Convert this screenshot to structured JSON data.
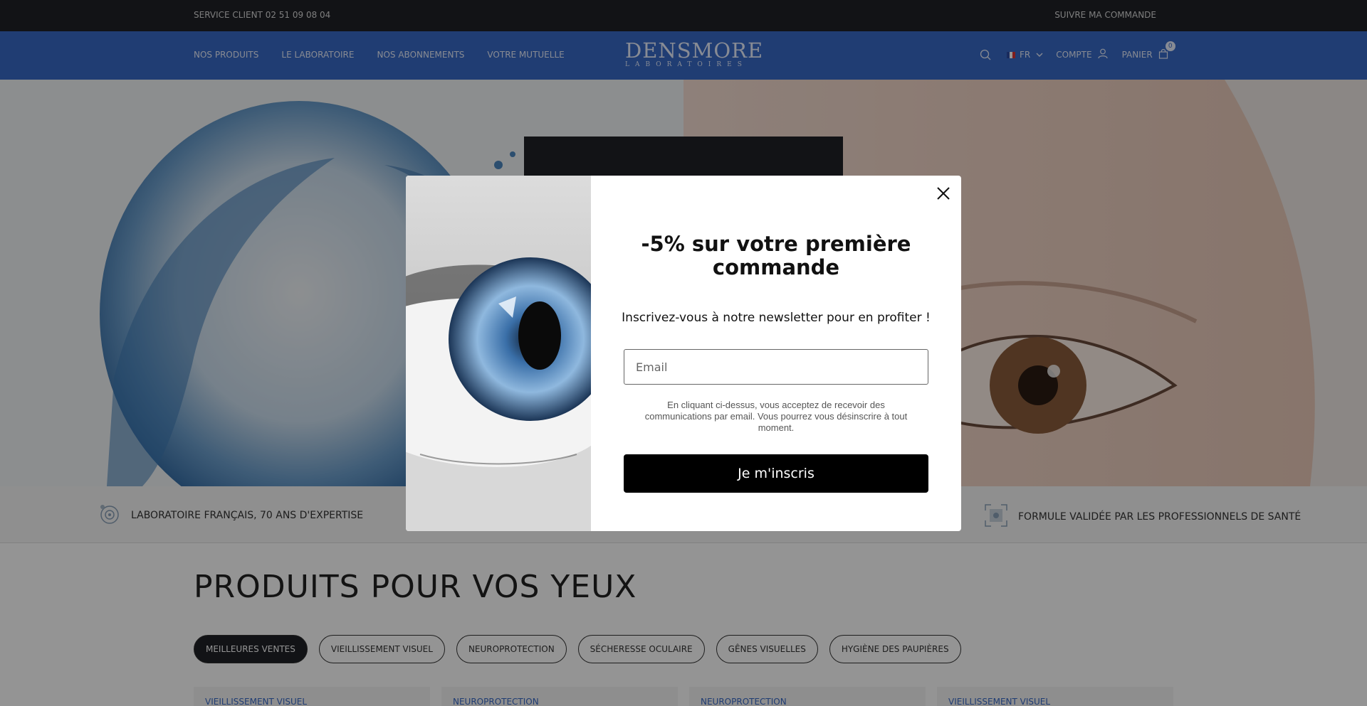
{
  "topbar": {
    "service_client": "SERVICE CLIENT 02 51 09 08 04",
    "track_order": "SUIVRE MA COMMANDE"
  },
  "header": {
    "nav": [
      "NOS PRODUITS",
      "LE LABORATOIRE",
      "NOS ABONNEMENTS",
      "VOTRE MUTUELLE"
    ],
    "logo_main": "DENSMORE",
    "logo_sub": "LABORATOIRES",
    "language": "FR",
    "account": "COMPTE",
    "cart": "PANIER",
    "cart_count": "0",
    "icons": {
      "search": "search-icon",
      "account": "user-icon",
      "cart": "bag-icon",
      "language": "chevron-down-icon"
    },
    "brand_color": "#3869c7"
  },
  "features": [
    {
      "label": "LABORATOIRE FRANÇAIS, 70 ANS D'EXPERTISE",
      "icon": "eye-icon"
    },
    {
      "label": "FORMULE VALIDÉE PAR LES PROFESSIONNELS DE SANTÉ",
      "icon": "scan-icon"
    }
  ],
  "products": {
    "title": "PRODUITS POUR VOS YEUX",
    "tabs": [
      "MEILLEURES VENTES",
      "VIEILLISSEMENT VISUEL",
      "NEUROPROTECTION",
      "SÉCHERESSE OCULAIRE",
      "GÊNES VISUELLES",
      "HYGIÈNE DES PAUPIÈRES"
    ],
    "active_tab": "MEILLEURES VENTES",
    "cards": [
      "VIEILLISSEMENT VISUEL",
      "NEUROPROTECTION",
      "NEUROPROTECTION",
      "VIEILLISSEMENT VISUEL"
    ]
  },
  "modal": {
    "title": "-5% sur votre première commande",
    "subtitle": "Inscrivez-vous à notre newsletter pour en profiter !",
    "email_placeholder": "Email",
    "legal": "En cliquant ci-dessus, vous acceptez de recevoir des communications par email. Vous pourrez vous désinscrire à tout moment.",
    "submit_label": "Je m'inscris",
    "close_icon": "close-icon"
  }
}
